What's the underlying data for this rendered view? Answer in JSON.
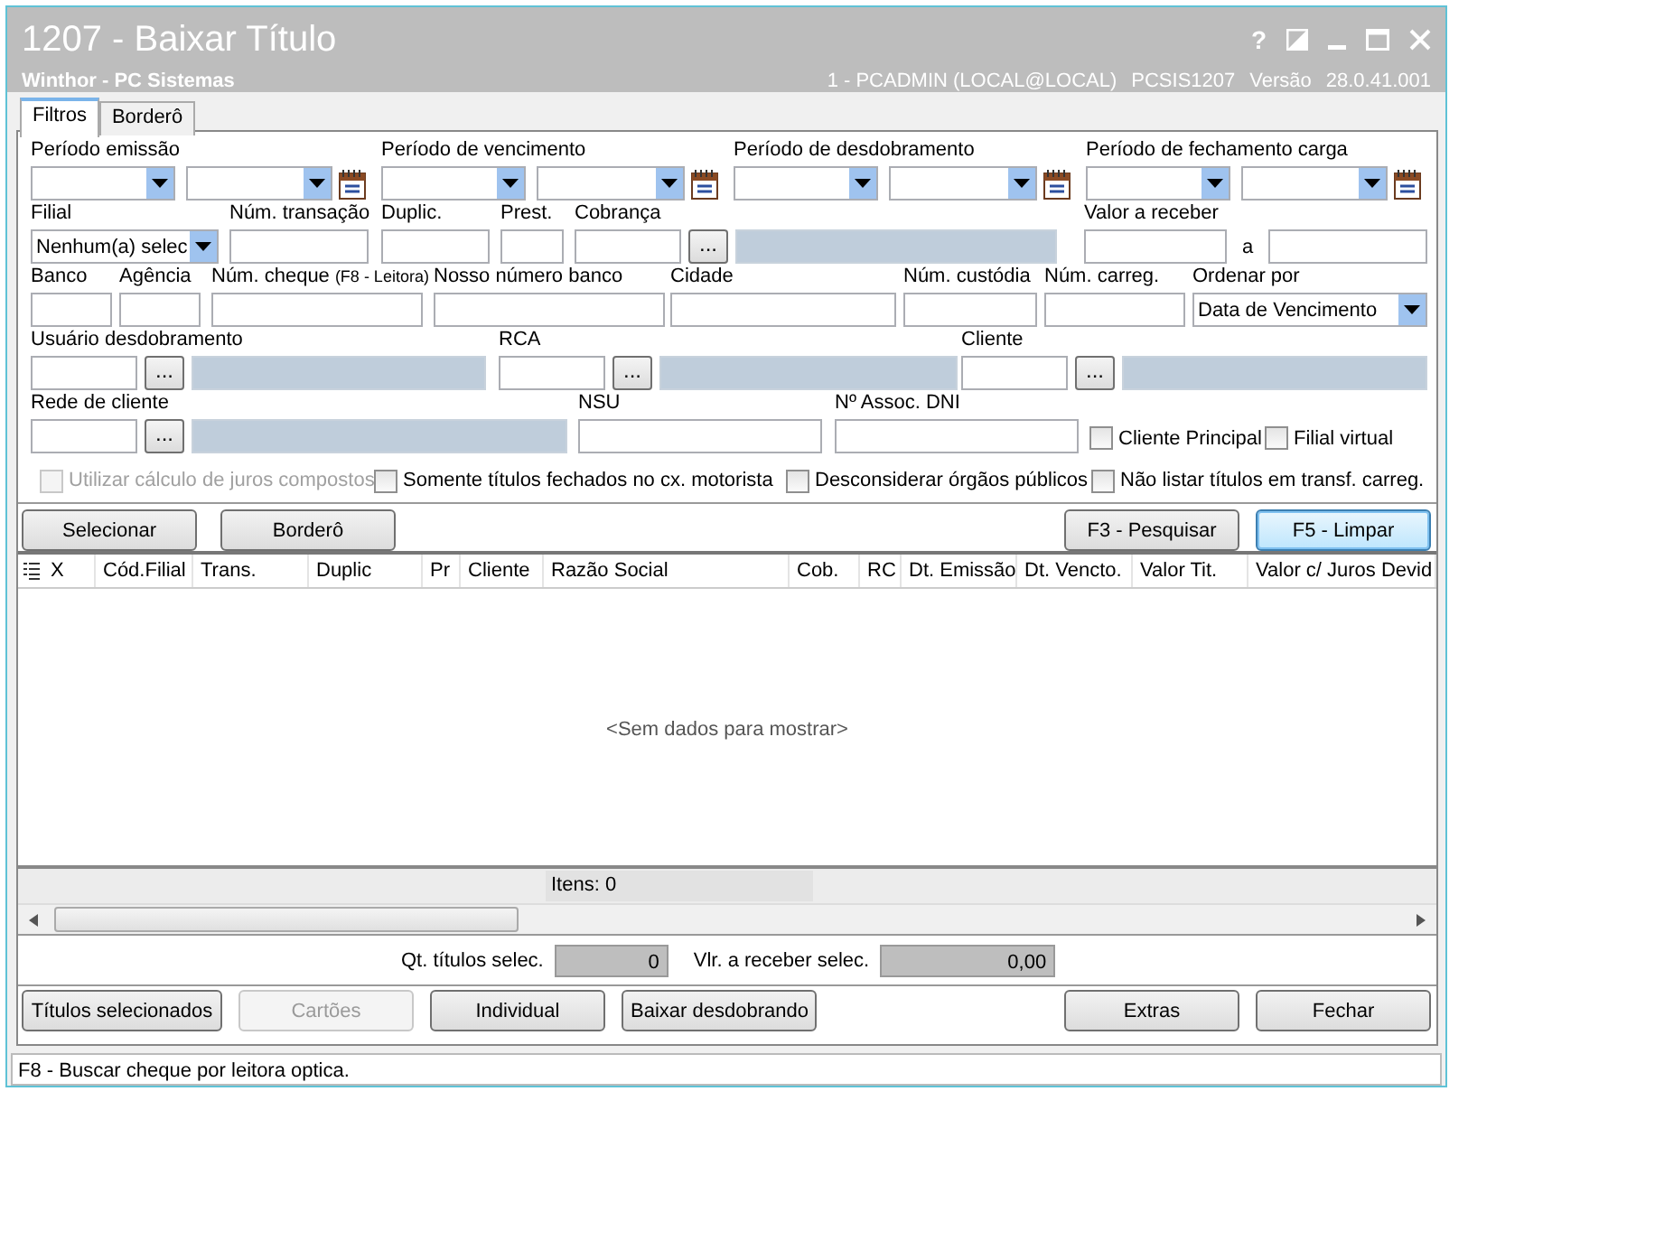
{
  "window": {
    "title": "1207 - Baixar Título",
    "subtitle": "Winthor - PC Sistemas",
    "user": "1 - PCADMIN (LOCAL@LOCAL)",
    "program": "PCSIS1207",
    "version_label": "Versão",
    "version": "28.0.41.001",
    "help": "?"
  },
  "tabs": [
    {
      "label": "Filtros",
      "selected": true
    },
    {
      "label": "Borderô",
      "selected": false
    }
  ],
  "filter_rows": [
    [
      {
        "kind": "period",
        "label": "Período emissão"
      },
      {
        "kind": "period",
        "label": "Período de vencimento"
      },
      {
        "kind": "period",
        "label": "Período de desdobramento"
      },
      {
        "kind": "period",
        "label": "Período de fechamento carga"
      }
    ],
    [
      {
        "kind": "combo",
        "label": "Filial",
        "value": "Nenhum(a) selec"
      },
      {
        "kind": "text",
        "label": "Núm. transação"
      },
      {
        "kind": "text",
        "label": "Duplic."
      },
      {
        "kind": "text",
        "label": "Prest."
      },
      {
        "kind": "lookup",
        "label": "Cobrança",
        "button": "..."
      },
      {
        "kind": "range",
        "label": "Valor a receber",
        "separator": "a"
      }
    ],
    [
      {
        "kind": "text",
        "label": "Banco"
      },
      {
        "kind": "text",
        "label": "Agência"
      },
      {
        "kind": "text",
        "label": "Núm. cheque",
        "hint": "(F8 - Leitora)"
      },
      {
        "kind": "text",
        "label": "Nosso número banco"
      },
      {
        "kind": "text",
        "label": "Cidade"
      },
      {
        "kind": "text",
        "label": "Núm. custódia"
      },
      {
        "kind": "text",
        "label": "Núm. carreg."
      },
      {
        "kind": "combo",
        "label": "Ordenar por",
        "value": "Data de Vencimento"
      }
    ],
    [
      {
        "kind": "lookup",
        "label": "Usuário desdobramento",
        "button": "..."
      },
      {
        "kind": "lookup",
        "label": "RCA",
        "button": "..."
      },
      {
        "kind": "lookup",
        "label": "Cliente",
        "button": "..."
      }
    ],
    [
      {
        "kind": "lookup",
        "label": "Rede de cliente",
        "button": "..."
      },
      {
        "kind": "text",
        "label": "NSU"
      },
      {
        "kind": "text",
        "label": "Nº Assoc. DNI"
      },
      {
        "kind": "checkbox",
        "label": "Cliente Principal",
        "checked": false,
        "disabled": false
      },
      {
        "kind": "checkbox",
        "label": "Filial virtual",
        "checked": false,
        "disabled": false
      }
    ],
    [
      {
        "kind": "checkbox",
        "label": "Utilizar cálculo de juros compostos",
        "checked": false,
        "disabled": true
      },
      {
        "kind": "checkbox",
        "label": "Somente títulos fechados no cx. motorista",
        "checked": false,
        "disabled": false
      },
      {
        "kind": "checkbox",
        "label": "Desconsiderar órgãos públicos",
        "checked": false,
        "disabled": false
      },
      {
        "kind": "checkbox",
        "label": "Não listar títulos em transf. carreg.",
        "checked": false,
        "disabled": false
      }
    ]
  ],
  "actions_top": {
    "left": [
      {
        "label": "Selecionar",
        "disabled": false,
        "focused": false
      },
      {
        "label": "Borderô",
        "disabled": false,
        "focused": false
      }
    ],
    "right": [
      {
        "label": "F3 - Pesquisar",
        "disabled": false,
        "focused": false
      },
      {
        "label": "F5 - Limpar",
        "disabled": false,
        "focused": true
      }
    ]
  },
  "grid": {
    "columns": [
      "X",
      "Cód.Filial",
      "Trans.",
      "Duplic",
      "Pr",
      "Cliente",
      "Razão Social",
      "Cob.",
      "RC",
      "Dt. Emissão",
      "Dt. Vencto.",
      "Valor Tit.",
      "Valor c/ Juros Devid"
    ],
    "empty_text": "<Sem dados para mostrar>",
    "footer": "Itens: 0"
  },
  "totals": [
    {
      "label": "Qt. títulos selec.",
      "value": "0"
    },
    {
      "label": "Vlr. a receber selec.",
      "value": "0,00"
    }
  ],
  "actions_bottom": {
    "left": [
      {
        "label": "Títulos selecionados",
        "disabled": false,
        "focused": false
      },
      {
        "label": "Cartões",
        "disabled": true,
        "focused": false
      },
      {
        "label": "Individual",
        "disabled": false,
        "focused": false
      },
      {
        "label": "Baixar desdobrando",
        "disabled": false,
        "focused": false
      }
    ],
    "right": [
      {
        "label": "Extras",
        "disabled": false,
        "focused": false
      },
      {
        "label": "Fechar",
        "disabled": false,
        "focused": false
      }
    ]
  },
  "status_bar": "F8 - Buscar cheque por leitora optica."
}
